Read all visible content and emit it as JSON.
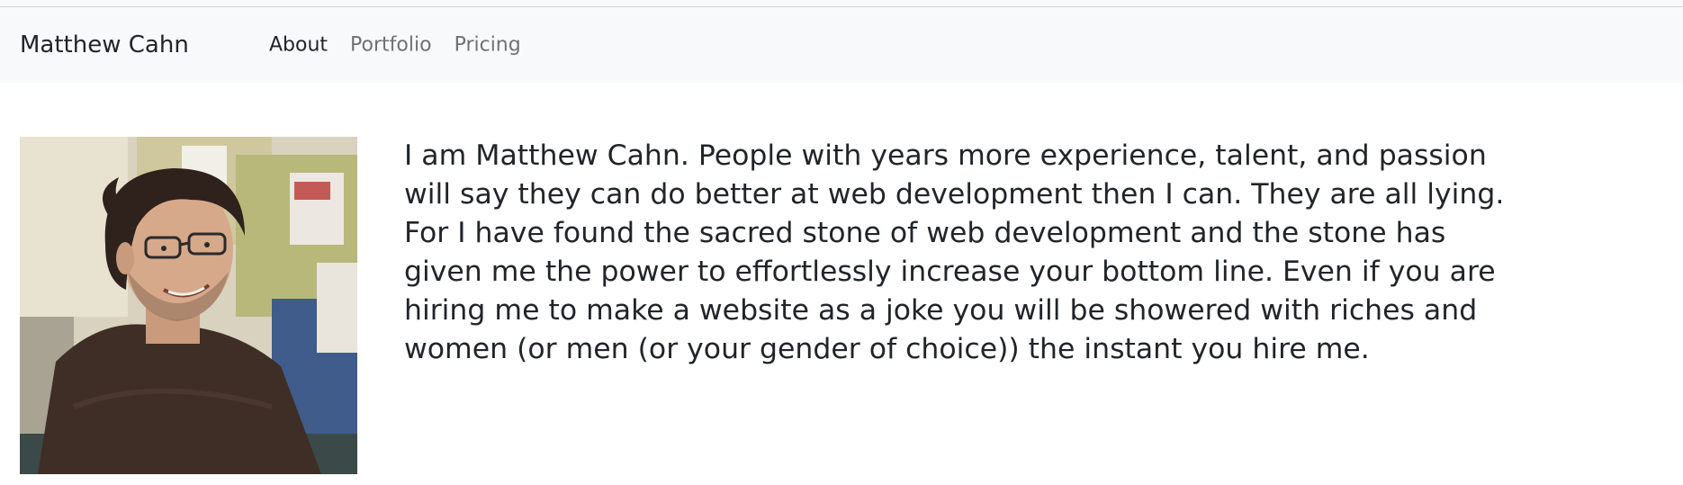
{
  "navbar": {
    "brand": "Matthew Cahn",
    "links": [
      {
        "label": "About",
        "active": true
      },
      {
        "label": "Portfolio",
        "active": false
      },
      {
        "label": "Pricing",
        "active": false
      }
    ]
  },
  "main": {
    "bio": "I am Matthew Cahn. People with years more experience, talent, and passion will say they can do better at web development then I can. They are all lying. For I have found the sacred stone of web development and the stone has given me the power to effortlessly increase your bottom line. Even if you are hiring me to make a website as a joke you will be showered with riches and women (or men (or your gender of choice)) the instant you hire me."
  },
  "colors": {
    "navbar_bg": "#f8f9fa",
    "text": "#212529",
    "nav_inactive": "#7a7b7c"
  }
}
